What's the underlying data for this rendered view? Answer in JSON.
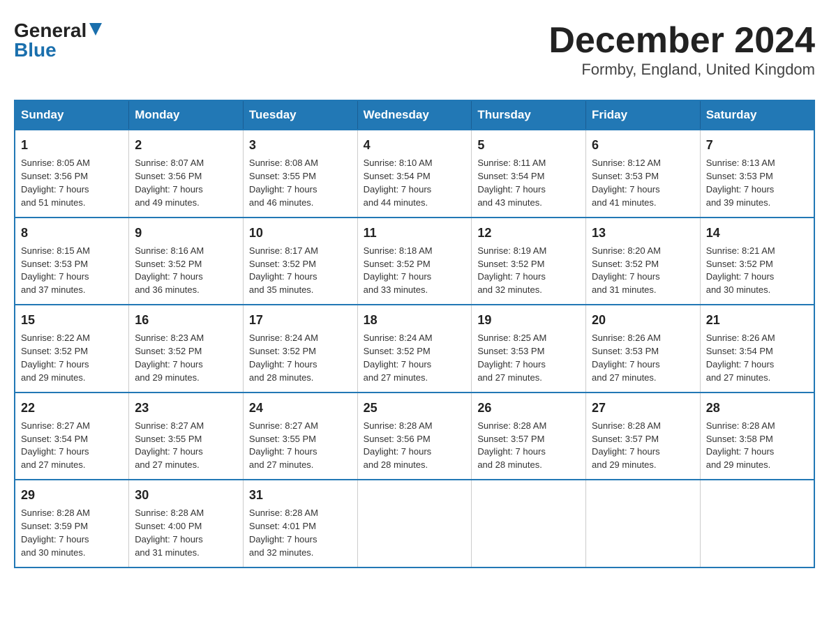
{
  "logo": {
    "general": "General",
    "blue": "Blue"
  },
  "title": "December 2024",
  "subtitle": "Formby, England, United Kingdom",
  "days_of_week": [
    "Sunday",
    "Monday",
    "Tuesday",
    "Wednesday",
    "Thursday",
    "Friday",
    "Saturday"
  ],
  "weeks": [
    [
      {
        "day": "1",
        "sunrise": "Sunrise: 8:05 AM",
        "sunset": "Sunset: 3:56 PM",
        "daylight": "Daylight: 7 hours and 51 minutes."
      },
      {
        "day": "2",
        "sunrise": "Sunrise: 8:07 AM",
        "sunset": "Sunset: 3:56 PM",
        "daylight": "Daylight: 7 hours and 49 minutes."
      },
      {
        "day": "3",
        "sunrise": "Sunrise: 8:08 AM",
        "sunset": "Sunset: 3:55 PM",
        "daylight": "Daylight: 7 hours and 46 minutes."
      },
      {
        "day": "4",
        "sunrise": "Sunrise: 8:10 AM",
        "sunset": "Sunset: 3:54 PM",
        "daylight": "Daylight: 7 hours and 44 minutes."
      },
      {
        "day": "5",
        "sunrise": "Sunrise: 8:11 AM",
        "sunset": "Sunset: 3:54 PM",
        "daylight": "Daylight: 7 hours and 43 minutes."
      },
      {
        "day": "6",
        "sunrise": "Sunrise: 8:12 AM",
        "sunset": "Sunset: 3:53 PM",
        "daylight": "Daylight: 7 hours and 41 minutes."
      },
      {
        "day": "7",
        "sunrise": "Sunrise: 8:13 AM",
        "sunset": "Sunset: 3:53 PM",
        "daylight": "Daylight: 7 hours and 39 minutes."
      }
    ],
    [
      {
        "day": "8",
        "sunrise": "Sunrise: 8:15 AM",
        "sunset": "Sunset: 3:53 PM",
        "daylight": "Daylight: 7 hours and 37 minutes."
      },
      {
        "day": "9",
        "sunrise": "Sunrise: 8:16 AM",
        "sunset": "Sunset: 3:52 PM",
        "daylight": "Daylight: 7 hours and 36 minutes."
      },
      {
        "day": "10",
        "sunrise": "Sunrise: 8:17 AM",
        "sunset": "Sunset: 3:52 PM",
        "daylight": "Daylight: 7 hours and 35 minutes."
      },
      {
        "day": "11",
        "sunrise": "Sunrise: 8:18 AM",
        "sunset": "Sunset: 3:52 PM",
        "daylight": "Daylight: 7 hours and 33 minutes."
      },
      {
        "day": "12",
        "sunrise": "Sunrise: 8:19 AM",
        "sunset": "Sunset: 3:52 PM",
        "daylight": "Daylight: 7 hours and 32 minutes."
      },
      {
        "day": "13",
        "sunrise": "Sunrise: 8:20 AM",
        "sunset": "Sunset: 3:52 PM",
        "daylight": "Daylight: 7 hours and 31 minutes."
      },
      {
        "day": "14",
        "sunrise": "Sunrise: 8:21 AM",
        "sunset": "Sunset: 3:52 PM",
        "daylight": "Daylight: 7 hours and 30 minutes."
      }
    ],
    [
      {
        "day": "15",
        "sunrise": "Sunrise: 8:22 AM",
        "sunset": "Sunset: 3:52 PM",
        "daylight": "Daylight: 7 hours and 29 minutes."
      },
      {
        "day": "16",
        "sunrise": "Sunrise: 8:23 AM",
        "sunset": "Sunset: 3:52 PM",
        "daylight": "Daylight: 7 hours and 29 minutes."
      },
      {
        "day": "17",
        "sunrise": "Sunrise: 8:24 AM",
        "sunset": "Sunset: 3:52 PM",
        "daylight": "Daylight: 7 hours and 28 minutes."
      },
      {
        "day": "18",
        "sunrise": "Sunrise: 8:24 AM",
        "sunset": "Sunset: 3:52 PM",
        "daylight": "Daylight: 7 hours and 27 minutes."
      },
      {
        "day": "19",
        "sunrise": "Sunrise: 8:25 AM",
        "sunset": "Sunset: 3:53 PM",
        "daylight": "Daylight: 7 hours and 27 minutes."
      },
      {
        "day": "20",
        "sunrise": "Sunrise: 8:26 AM",
        "sunset": "Sunset: 3:53 PM",
        "daylight": "Daylight: 7 hours and 27 minutes."
      },
      {
        "day": "21",
        "sunrise": "Sunrise: 8:26 AM",
        "sunset": "Sunset: 3:54 PM",
        "daylight": "Daylight: 7 hours and 27 minutes."
      }
    ],
    [
      {
        "day": "22",
        "sunrise": "Sunrise: 8:27 AM",
        "sunset": "Sunset: 3:54 PM",
        "daylight": "Daylight: 7 hours and 27 minutes."
      },
      {
        "day": "23",
        "sunrise": "Sunrise: 8:27 AM",
        "sunset": "Sunset: 3:55 PM",
        "daylight": "Daylight: 7 hours and 27 minutes."
      },
      {
        "day": "24",
        "sunrise": "Sunrise: 8:27 AM",
        "sunset": "Sunset: 3:55 PM",
        "daylight": "Daylight: 7 hours and 27 minutes."
      },
      {
        "day": "25",
        "sunrise": "Sunrise: 8:28 AM",
        "sunset": "Sunset: 3:56 PM",
        "daylight": "Daylight: 7 hours and 28 minutes."
      },
      {
        "day": "26",
        "sunrise": "Sunrise: 8:28 AM",
        "sunset": "Sunset: 3:57 PM",
        "daylight": "Daylight: 7 hours and 28 minutes."
      },
      {
        "day": "27",
        "sunrise": "Sunrise: 8:28 AM",
        "sunset": "Sunset: 3:57 PM",
        "daylight": "Daylight: 7 hours and 29 minutes."
      },
      {
        "day": "28",
        "sunrise": "Sunrise: 8:28 AM",
        "sunset": "Sunset: 3:58 PM",
        "daylight": "Daylight: 7 hours and 29 minutes."
      }
    ],
    [
      {
        "day": "29",
        "sunrise": "Sunrise: 8:28 AM",
        "sunset": "Sunset: 3:59 PM",
        "daylight": "Daylight: 7 hours and 30 minutes."
      },
      {
        "day": "30",
        "sunrise": "Sunrise: 8:28 AM",
        "sunset": "Sunset: 4:00 PM",
        "daylight": "Daylight: 7 hours and 31 minutes."
      },
      {
        "day": "31",
        "sunrise": "Sunrise: 8:28 AM",
        "sunset": "Sunset: 4:01 PM",
        "daylight": "Daylight: 7 hours and 32 minutes."
      },
      null,
      null,
      null,
      null
    ]
  ]
}
